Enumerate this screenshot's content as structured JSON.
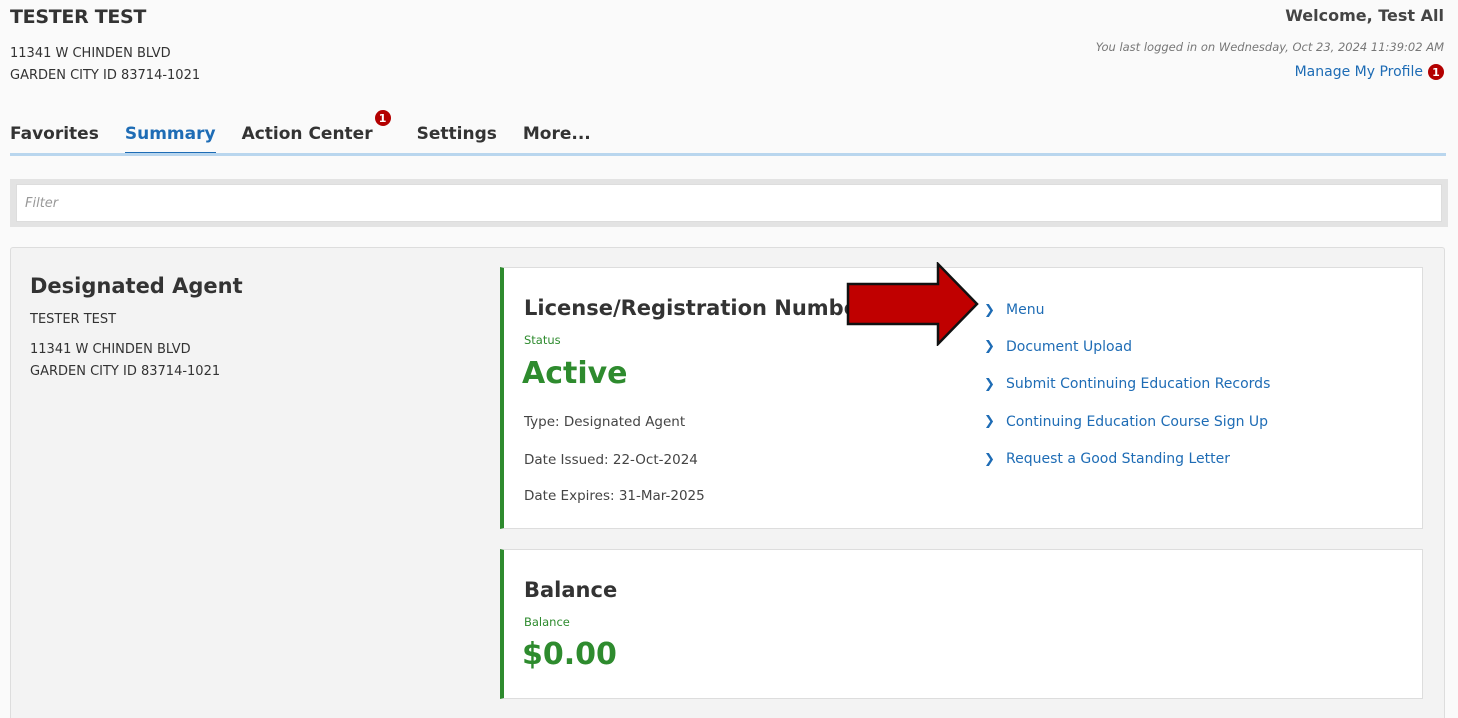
{
  "header": {
    "company_name": "TESTER TEST",
    "address_line1": "11341 W CHINDEN BLVD",
    "address_line2": "GARDEN CITY ID 83714-1021",
    "welcome": "Welcome, Test All",
    "last_login": "You last logged in on Wednesday, Oct 23, 2024 11:39:02 AM",
    "manage_profile": "Manage My Profile",
    "manage_profile_badge": "1"
  },
  "tabs": [
    {
      "label": "Favorites"
    },
    {
      "label": "Summary",
      "active": true
    },
    {
      "label": "Action Center",
      "badge": "1"
    },
    {
      "label": "Settings"
    },
    {
      "label": "More..."
    }
  ],
  "filter": {
    "placeholder": "Filter",
    "value": ""
  },
  "agent": {
    "title": "Designated Agent",
    "name": "TESTER TEST",
    "address_line1": "11341 W CHINDEN BLVD",
    "address_line2": "GARDEN CITY ID 83714-1021"
  },
  "license_card": {
    "title": "License/Registration Number",
    "status_label": "Status",
    "status": "Active",
    "type": "Type: Designated Agent",
    "issued": "Date Issued: 22-Oct-2024",
    "expires": "Date Expires: 31-Mar-2025"
  },
  "links": [
    {
      "label": "Menu"
    },
    {
      "label": "Document Upload"
    },
    {
      "label": "Submit Continuing Education Records"
    },
    {
      "label": "Continuing Education Course Sign Up"
    },
    {
      "label": "Request a Good Standing Letter"
    }
  ],
  "balance_card": {
    "title": "Balance",
    "label": "Balance",
    "amount": "$0.00"
  },
  "colors": {
    "accent_blue": "#1e6cb5",
    "status_green": "#2e8b2e",
    "badge_red": "#b30000",
    "arrow_red": "#c00000"
  },
  "icons": [
    "chevron-right-icon",
    "notification-badge-icon",
    "red-pointer-arrow-icon"
  ]
}
